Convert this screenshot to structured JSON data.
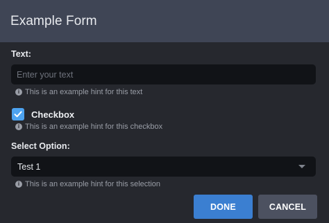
{
  "dialog": {
    "title": "Example Form"
  },
  "text_field": {
    "label": "Text:",
    "value": "",
    "placeholder": "Enter your text",
    "hint": "This is an example hint for this text"
  },
  "checkbox": {
    "label": "Checkbox",
    "checked": true,
    "hint": "This is an example hint for this checkbox"
  },
  "select": {
    "label": "Select Option:",
    "selected": "Test 1",
    "hint": "This is an example hint for this selection"
  },
  "buttons": {
    "done": "DONE",
    "cancel": "CANCEL"
  },
  "colors": {
    "titlebar": "#3f4555",
    "background": "#26282e",
    "input": "#111317",
    "accent": "#4da3f0",
    "done_button": "#3b7fd1",
    "cancel_button": "#4c5160"
  },
  "icons": {
    "hint": "info-icon",
    "checkbox": "check-icon",
    "select": "chevron-down-icon"
  }
}
